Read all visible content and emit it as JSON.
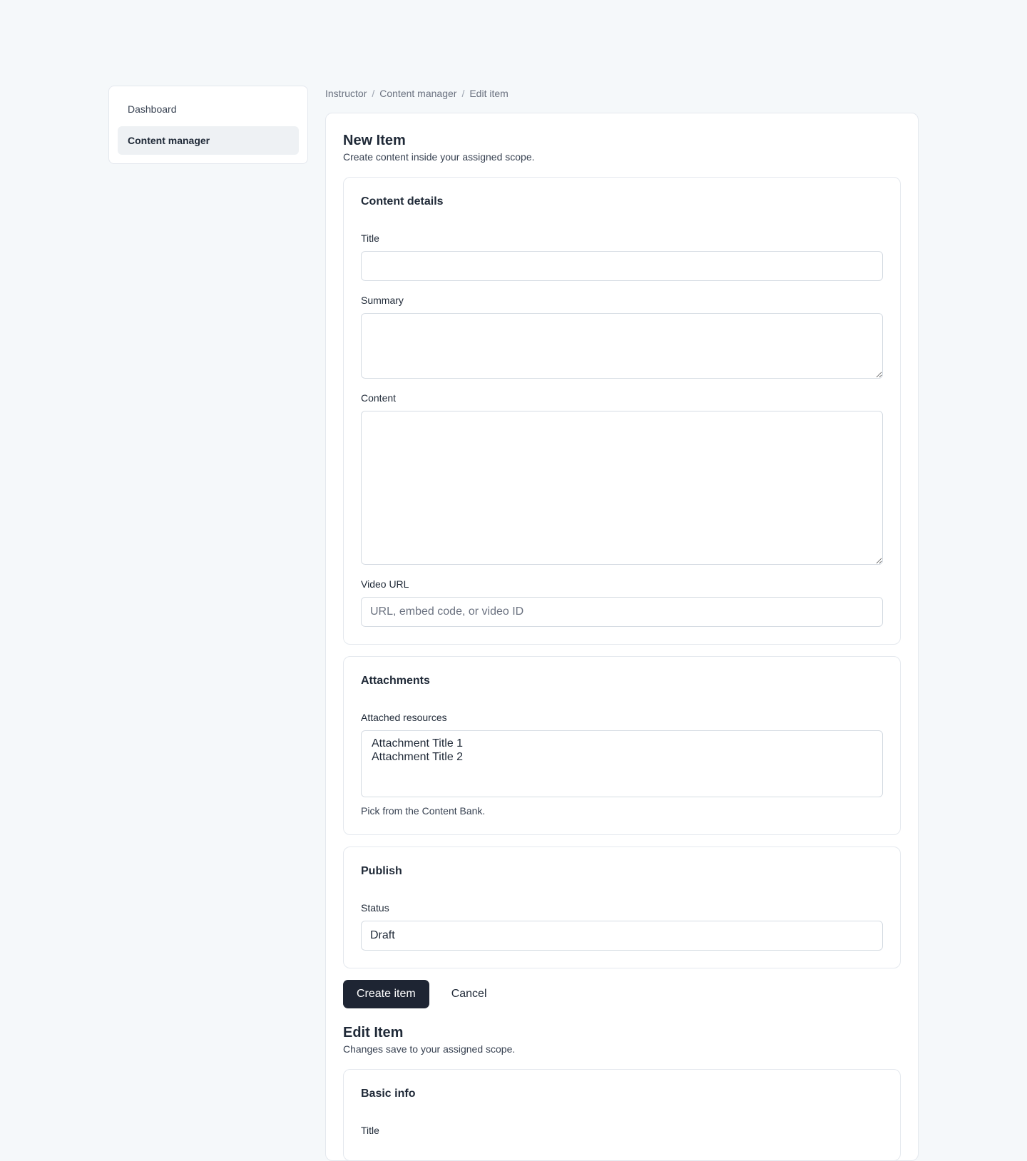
{
  "sidebar": {
    "items": [
      {
        "label": "Dashboard"
      },
      {
        "label": "Content manager"
      }
    ]
  },
  "breadcrumb": {
    "items": [
      "Instructor",
      "Content manager",
      "Edit item"
    ],
    "separator": "/"
  },
  "new_item": {
    "title": "New Item",
    "subtitle": "Create content inside your assigned scope.",
    "content_details": {
      "heading": "Content details",
      "title_label": "Title",
      "title_value": "",
      "summary_label": "Summary",
      "summary_value": "",
      "content_label": "Content",
      "content_value": "",
      "video_url_label": "Video URL",
      "video_url_placeholder": "URL, embed code, or video ID"
    },
    "attachments": {
      "heading": "Attachments",
      "label": "Attached resources",
      "options": [
        "Attachment Title 1",
        "Attachment Title 2"
      ],
      "help": "Pick from the Content Bank."
    },
    "publish": {
      "heading": "Publish",
      "status_label": "Status",
      "status_value": "Draft"
    },
    "actions": {
      "create_label": "Create item",
      "cancel_label": "Cancel"
    }
  },
  "edit_item": {
    "title": "Edit Item",
    "subtitle": "Changes save to your assigned scope.",
    "basic_info": {
      "heading": "Basic info",
      "title_label": "Title"
    }
  },
  "colors": {
    "background": "#f5f8fa",
    "primary_button": "#1e2533",
    "border": "#e4e8ee",
    "active_nav": "#eef1f4"
  }
}
